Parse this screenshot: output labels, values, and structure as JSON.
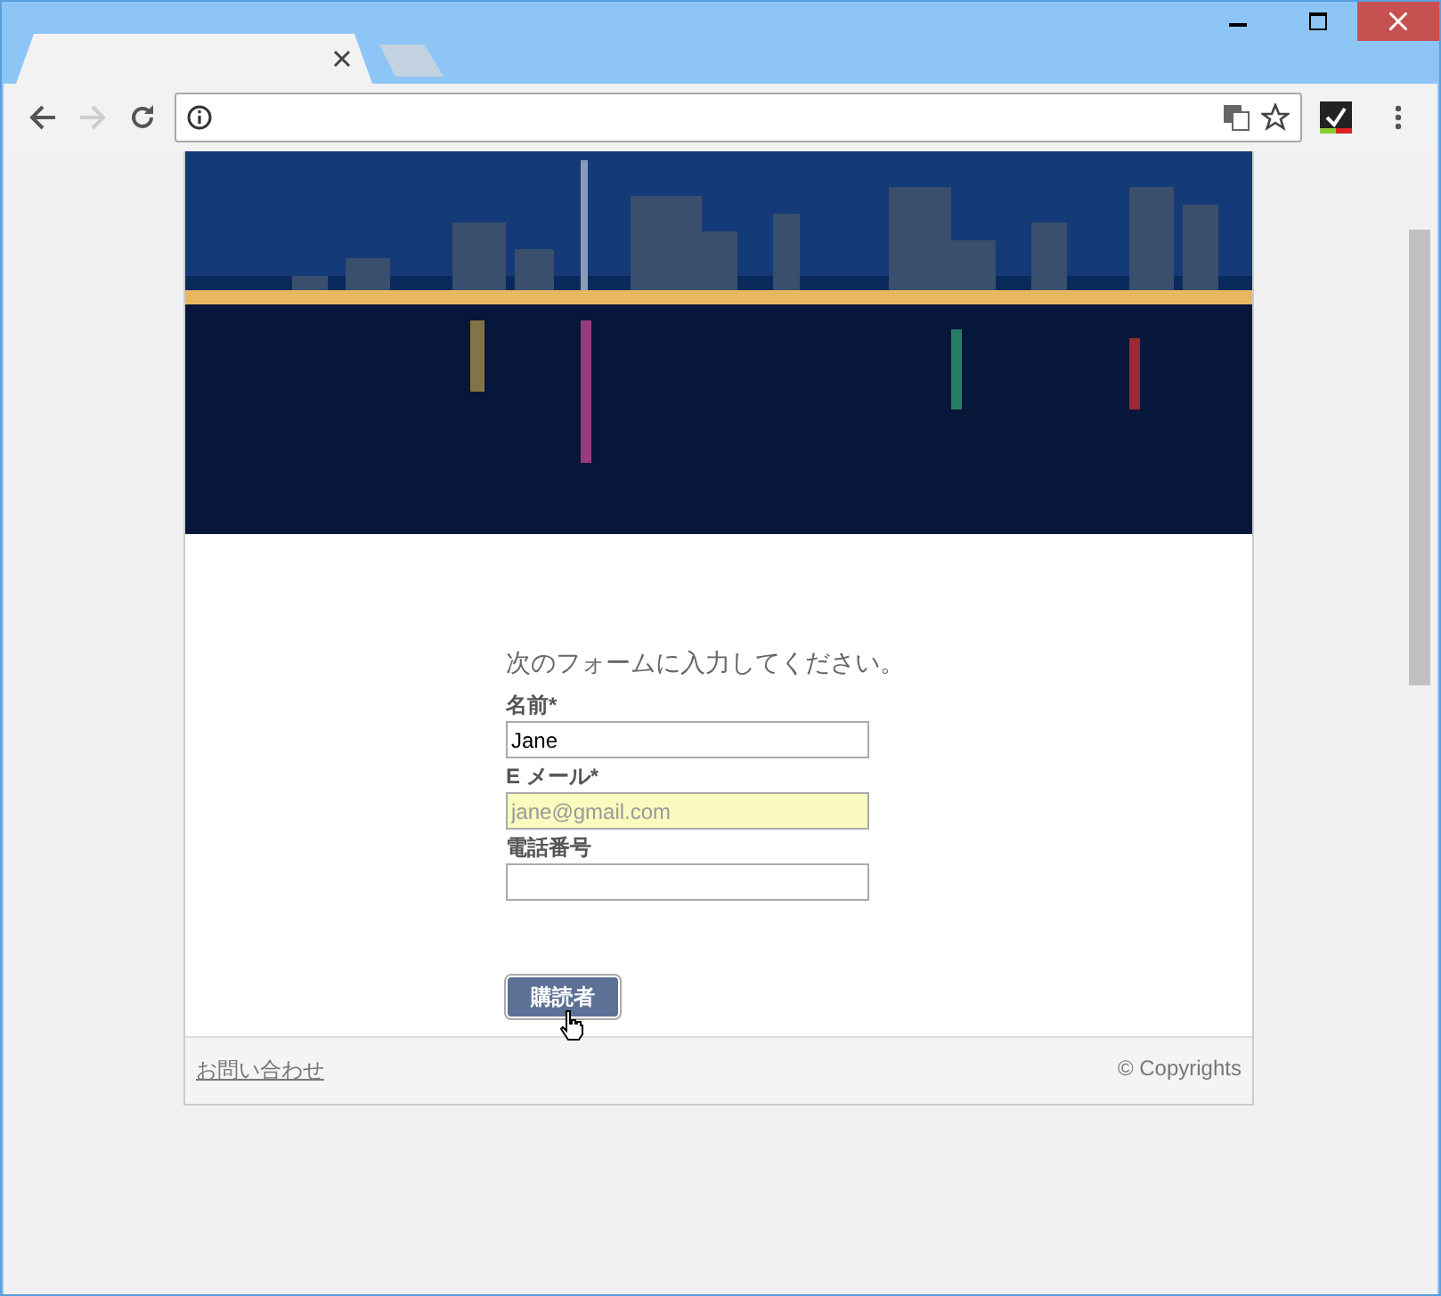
{
  "browser": {
    "tabs": [
      {
        "selected": true
      },
      {
        "selected": false
      }
    ]
  },
  "form": {
    "intro": "次のフォームに入力してください。",
    "fields": [
      {
        "label": "名前*",
        "value": "Jane",
        "autofilled": false
      },
      {
        "label": "E メール*",
        "value": "jane@gmail.com",
        "autofilled": true
      },
      {
        "label": "電話番号",
        "autofilled": false
      }
    ],
    "submit": "購読者"
  },
  "footer": {
    "link": "お問い合わせ",
    "copyright": "© Copyrights"
  }
}
